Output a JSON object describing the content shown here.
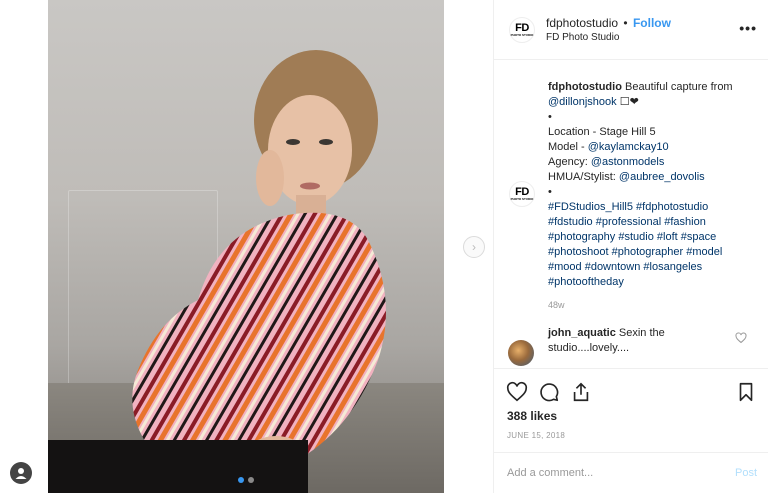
{
  "header": {
    "logo_text": "FD",
    "logo_sub": "PHOTO STUDIO",
    "username": "fdphotostudio",
    "separator": "•",
    "follow_label": "Follow",
    "display_name": "FD Photo Studio",
    "more_label": "•••"
  },
  "photo": {
    "carousel_dots": 2,
    "active_dot": 1
  },
  "caption": {
    "username": "fdphotostudio",
    "intro": "Beautiful capture from",
    "photographer": "@dillonjshook",
    "emoji": "☐❤",
    "bullet1": "•",
    "location": "Location - Stage Hill 5",
    "model_label": "Model - ",
    "model_handle": "@kaylamckay10",
    "agency_label": "Agency: ",
    "agency_handle": "@astonmodels",
    "hmua_label": "HMUA/Stylist: ",
    "hmua_handle": "@aubree_dovolis",
    "bullet2": "•",
    "hashtags": [
      "#FDStudios_Hill5",
      "#fdphotostudio",
      "#fdstudio",
      "#professional",
      "#fashion",
      "#photography",
      "#studio",
      "#loft",
      "#space",
      "#photoshoot",
      "#photographer",
      "#model",
      "#mood",
      "#downtown",
      "#losangeles",
      "#photooftheday"
    ],
    "time_ago": "48w"
  },
  "comment": {
    "username": "john_aquatic",
    "text_line1": "Sexin the",
    "text_line2": "studio....lovely...."
  },
  "actions": {
    "likes": "388 likes",
    "date": "JUNE 15, 2018"
  },
  "add_comment": {
    "placeholder": "Add a comment...",
    "post_label": "Post"
  },
  "colors": {
    "accent": "#3897f0",
    "hashtag": "#003569",
    "muted": "#999999",
    "post_disabled": "#b2dffc"
  }
}
